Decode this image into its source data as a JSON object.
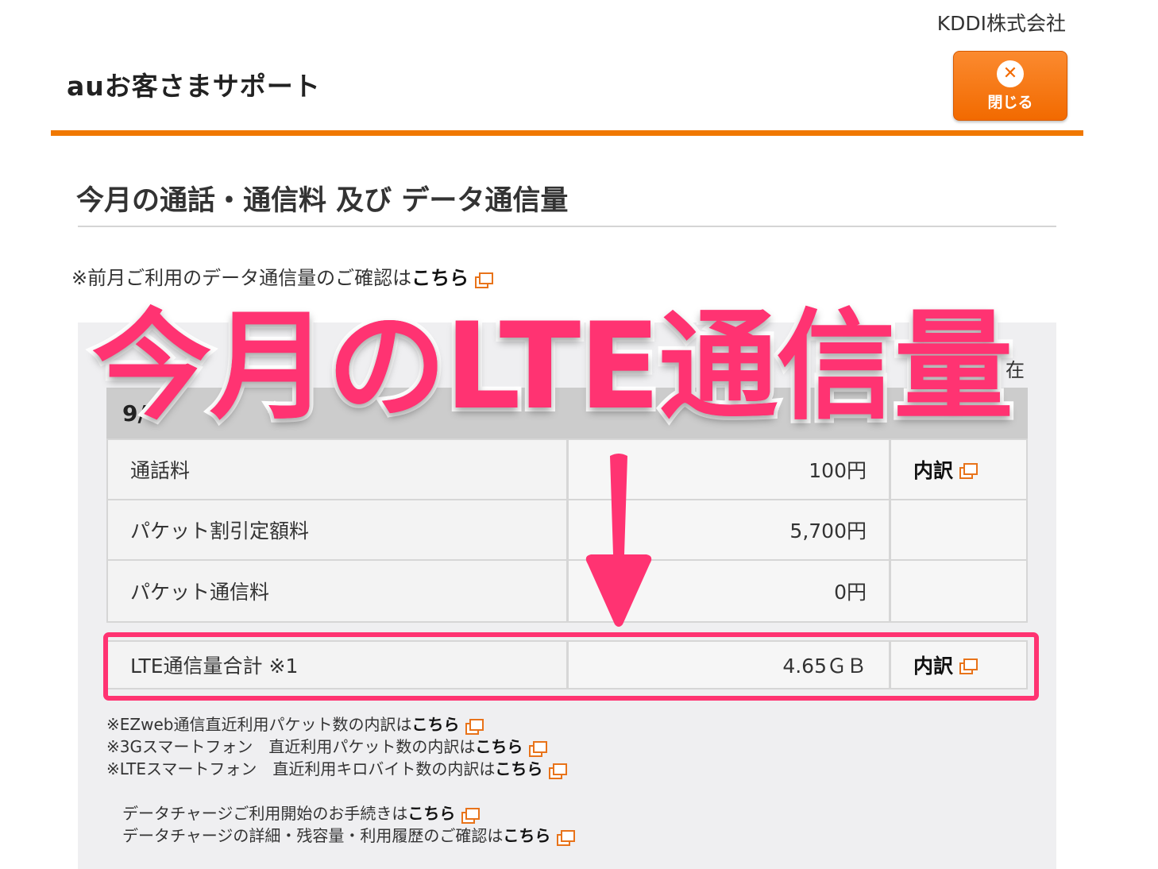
{
  "header": {
    "company": "KDDI株式会社",
    "site_title": "auお客さまサポート",
    "close_label": "閉じる"
  },
  "page": {
    "heading": "今月の通話・通信料 及び データ通信量",
    "prev_month_text": "※前月ご利用のデータ通信量のご確認は",
    "prev_month_link": "こちら"
  },
  "panel": {
    "as_of_suffix": "在",
    "table_head": "9/"
  },
  "table": {
    "rows": [
      {
        "label": "通話料",
        "value": "100円",
        "detail": "内訳"
      },
      {
        "label": "パケット割引定額料",
        "value": "5,700円",
        "detail": ""
      },
      {
        "label": "パケット通信料",
        "value": "0円",
        "detail": ""
      }
    ],
    "lte": {
      "label": "LTE通信量合計 ※1",
      "value": "4.65ＧＢ",
      "detail": "内訳"
    }
  },
  "notes": [
    {
      "text": "※EZweb通信直近利用パケット数の内訳は",
      "link": "こちら"
    },
    {
      "text": "※3Gスマートフォン　直近利用パケット数の内訳は",
      "link": "こちら"
    },
    {
      "text": "※LTEスマートフォン　直近利用キロバイト数の内訳は",
      "link": "こちら"
    }
  ],
  "charge_notes": [
    {
      "text": "データチャージご利用開始のお手続きは",
      "link": "こちら"
    },
    {
      "text": "データチャージの詳細・残容量・利用履歴のご確認は",
      "link": "こちら"
    }
  ],
  "annotation": {
    "label": "今月のLTE通信量",
    "color": "#ff3372"
  },
  "colors": {
    "brand_orange": "#f07800",
    "highlight": "#ff3372",
    "panel_bg": "#efeff1"
  }
}
